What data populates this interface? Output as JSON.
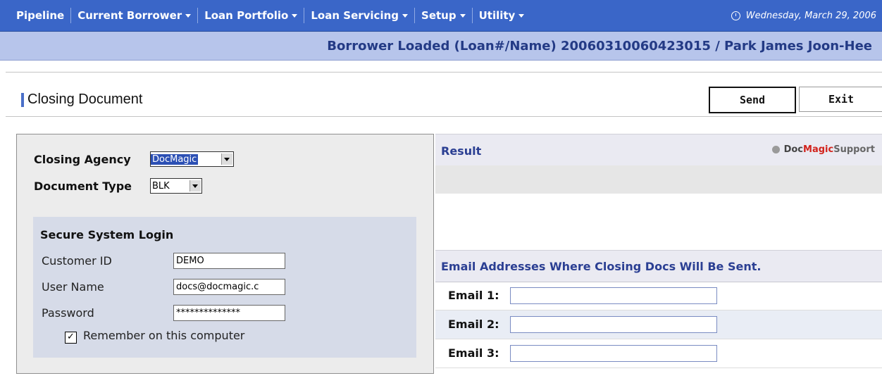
{
  "nav": {
    "items": [
      {
        "label": "Pipeline",
        "dropdown": false
      },
      {
        "label": "Current Borrower",
        "dropdown": true
      },
      {
        "label": "Loan Portfolio",
        "dropdown": true
      },
      {
        "label": "Loan Servicing",
        "dropdown": true
      },
      {
        "label": "Setup",
        "dropdown": true
      },
      {
        "label": "Utility",
        "dropdown": true
      }
    ],
    "date": "Wednesday, March 29, 2006"
  },
  "borrower_bar": "Borrower Loaded (Loan#/Name) 20060310060423015 / Park James Joon-Hee",
  "page": {
    "title": "Closing Document",
    "send_label": "Send",
    "exit_label": "Exit"
  },
  "form": {
    "closing_agency_label": "Closing Agency",
    "closing_agency_value": "DocMagic",
    "document_type_label": "Document Type",
    "document_type_value": "BLK",
    "login": {
      "heading": "Secure System Login",
      "customer_id_label": "Customer ID",
      "customer_id_value": "DEMO",
      "user_name_label": "User Name",
      "user_name_value": "docs@docmagic.c",
      "password_label": "Password",
      "password_value": "**************",
      "remember_label": "Remember on this computer",
      "remember_checked": true
    }
  },
  "result": {
    "title": "Result",
    "support_doc": "Doc",
    "support_magic": "Magic",
    "support_suffix": " Support"
  },
  "email": {
    "title": "Email Addresses Where Closing Docs Will Be Sent.",
    "rows": [
      {
        "label": "Email 1:",
        "value": ""
      },
      {
        "label": "Email 2:",
        "value": ""
      },
      {
        "label": "Email 3:",
        "value": ""
      }
    ]
  },
  "colors": {
    "nav_bg": "#3a66c8",
    "borrower_bg": "#b7c5eb",
    "heading_text": "#2b3f93",
    "magic_red": "#d2231c"
  }
}
